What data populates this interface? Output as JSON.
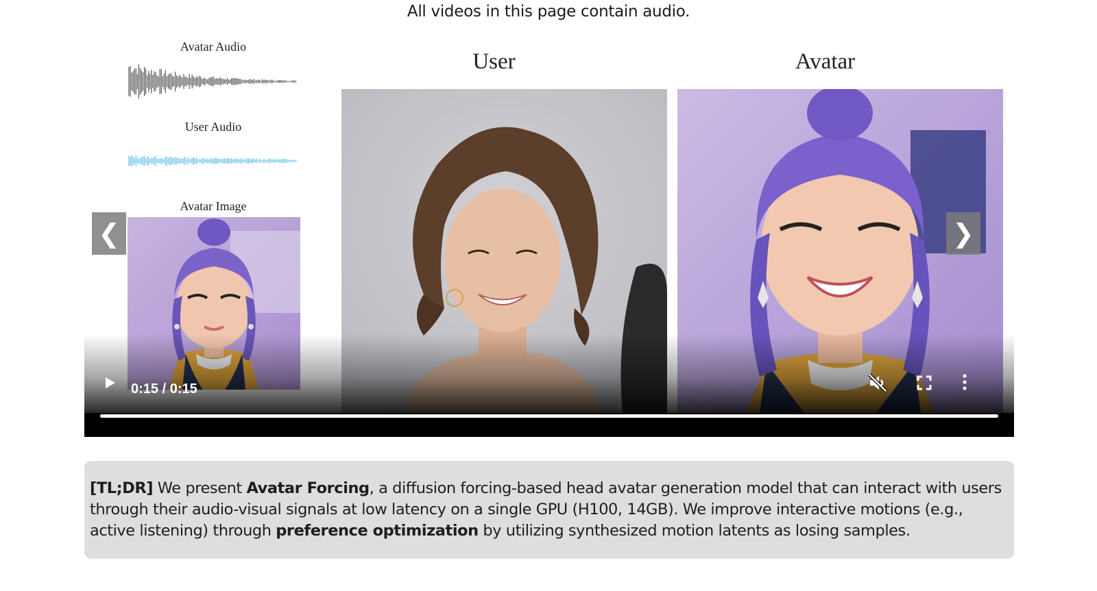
{
  "notice": "All videos in this page contain audio.",
  "video": {
    "labels": {
      "avatar_audio": "Avatar Audio",
      "user_audio": "User Audio",
      "avatar_image": "Avatar Image",
      "user": "User",
      "avatar": "Avatar"
    },
    "time": "0:15 / 0:15",
    "progress": 1.0,
    "muted": true,
    "prev_button": "❮",
    "next_button": "❯",
    "colors": {
      "avatar_wave": "#333333",
      "user_wave": "#4db4ec",
      "control_bar": "#000000"
    }
  },
  "tldr": {
    "prefix": "[TL;DR]",
    "t1": " We present ",
    "model_name": "Avatar Forcing",
    "t2": ", a diffusion forcing-based head avatar generation model that can interact with users through their audio-visual signals at low latency on a single GPU (H100, 14GB). We improve interactive motions (e.g., active listening) through ",
    "method": "preference optimization",
    "t3": " by utilizing synthesized motion latents as losing samples.",
    "background": "#dedede"
  }
}
